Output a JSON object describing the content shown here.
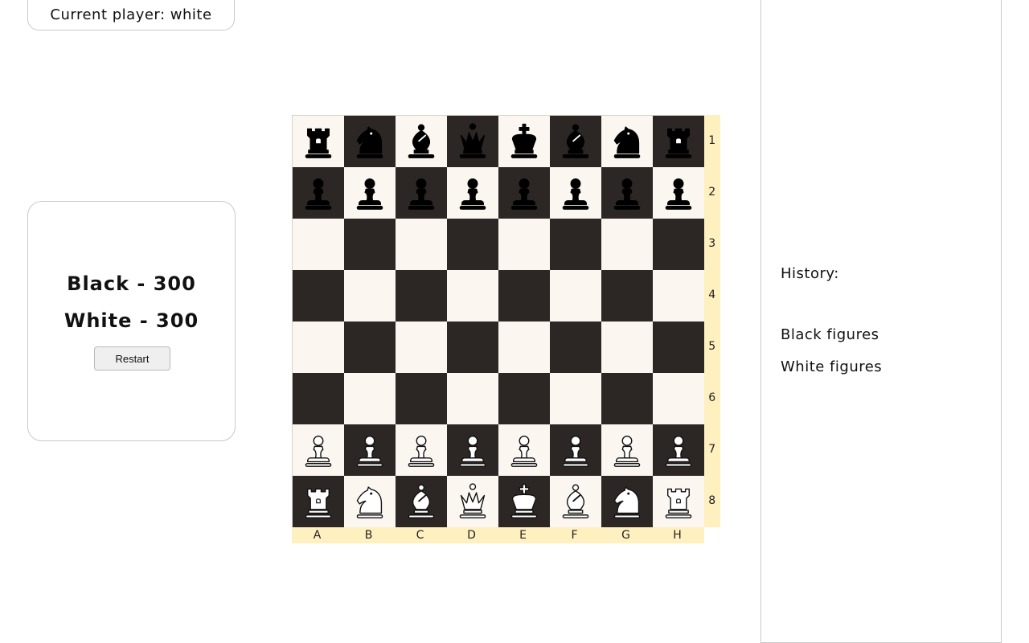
{
  "status": {
    "current_player": "Current player: white"
  },
  "scores": {
    "black": "Black - 300",
    "white": "White - 300",
    "restart_label": "Restart"
  },
  "history": {
    "title": "History:",
    "black_figures": "Black figures",
    "white_figures": "White figures"
  },
  "board": {
    "files": [
      "A",
      "B",
      "C",
      "D",
      "E",
      "F",
      "G",
      "H"
    ],
    "ranks": [
      "1",
      "2",
      "3",
      "4",
      "5",
      "6",
      "7",
      "8"
    ],
    "colors": {
      "light": "#fbf6f0",
      "dark": "#2c2724",
      "coord_strip": "#fff0c0"
    },
    "rows": [
      [
        "bR",
        "bN",
        "bB",
        "bQ",
        "bK",
        "bB",
        "bN",
        "bR"
      ],
      [
        "bP",
        "bP",
        "bP",
        "bP",
        "bP",
        "bP",
        "bP",
        "bP"
      ],
      [
        "",
        "",
        "",
        "",
        "",
        "",
        "",
        ""
      ],
      [
        "",
        "",
        "",
        "",
        "",
        "",
        "",
        ""
      ],
      [
        "",
        "",
        "",
        "",
        "",
        "",
        "",
        ""
      ],
      [
        "",
        "",
        "",
        "",
        "",
        "",
        "",
        ""
      ],
      [
        "wP",
        "wP",
        "wP",
        "wP",
        "wP",
        "wP",
        "wP",
        "wP"
      ],
      [
        "wR",
        "wN",
        "wB",
        "wQ",
        "wK",
        "wB",
        "wN",
        "wR"
      ]
    ]
  }
}
